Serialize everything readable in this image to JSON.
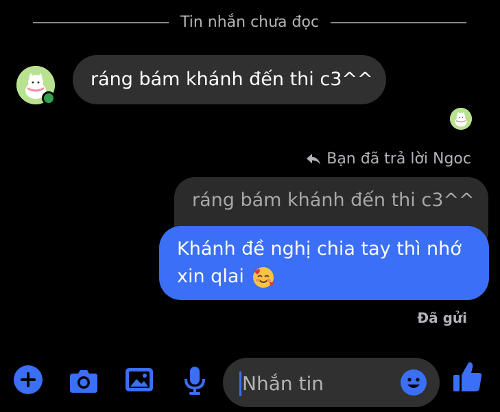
{
  "divider": {
    "label": "Tin nhắn chưa đọc"
  },
  "messages": {
    "incoming": {
      "text": "ráng bám khánh đến thi c3^^",
      "sender_online": true
    },
    "reply_meta": {
      "text": "Bạn đã trả lời Ngoc"
    },
    "quoted": {
      "text": "ráng bám khánh đến thi c3^^"
    },
    "outgoing": {
      "line1": "Khánh đề nghị chia tay thì nhớ",
      "line2": "xin qlai",
      "emoji": "smiling-face-with-hearts"
    },
    "status": "Đã gửi"
  },
  "composer": {
    "placeholder": "Nhắn tin",
    "value": ""
  },
  "toolbar": {
    "icons": [
      "plus-icon",
      "camera-icon",
      "image-icon",
      "microphone-icon",
      "emoji-icon",
      "thumbs-up-icon"
    ]
  },
  "colors": {
    "accent": "#3a6ff6",
    "incoming_bubble": "#303030",
    "online": "#31a24c",
    "background": "#000000"
  }
}
